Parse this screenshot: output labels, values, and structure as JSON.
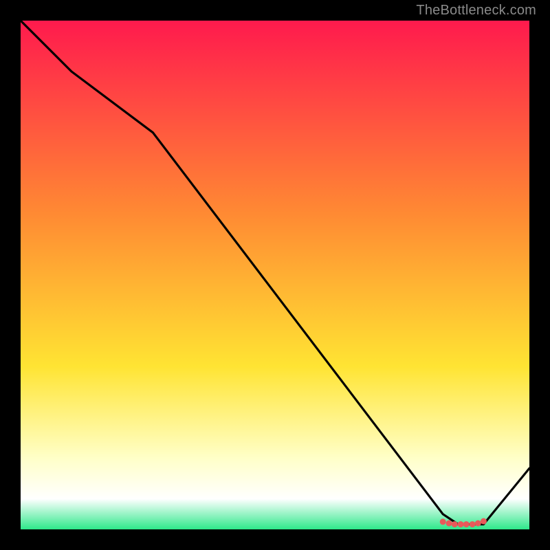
{
  "credit": "TheBottleneck.com",
  "colors": {
    "bg_black": "#000000",
    "line_black": "#000000",
    "marker_red": "#E85A5A",
    "grad_top": "#FF1A4D",
    "grad_mid1": "#FF8A33",
    "grad_mid2": "#FFE433",
    "grad_pale": "#FFFFC8",
    "grad_green": "#2EE88A"
  },
  "chart_data": {
    "type": "line",
    "title": "",
    "xlabel": "",
    "ylabel": "",
    "xlim": [
      0,
      100
    ],
    "ylim": [
      0,
      100
    ],
    "x": [
      0,
      10,
      26,
      83,
      86,
      91,
      100
    ],
    "y": [
      100,
      90,
      78,
      3,
      1,
      1,
      12
    ],
    "markers": {
      "x": [
        83,
        84.2,
        85.3,
        86.5,
        87.6,
        88.8,
        89.9,
        91
      ],
      "y": [
        1.5,
        1.2,
        1.0,
        1.0,
        1.0,
        1.0,
        1.2,
        1.6
      ]
    },
    "gradient_stops": [
      {
        "offset": 0.0,
        "color": "#FF1A4D"
      },
      {
        "offset": 0.38,
        "color": "#FF8A33"
      },
      {
        "offset": 0.68,
        "color": "#FFE433"
      },
      {
        "offset": 0.86,
        "color": "#FFFFC8"
      },
      {
        "offset": 0.94,
        "color": "#FFFFFF"
      },
      {
        "offset": 1.0,
        "color": "#2EE88A"
      }
    ]
  }
}
